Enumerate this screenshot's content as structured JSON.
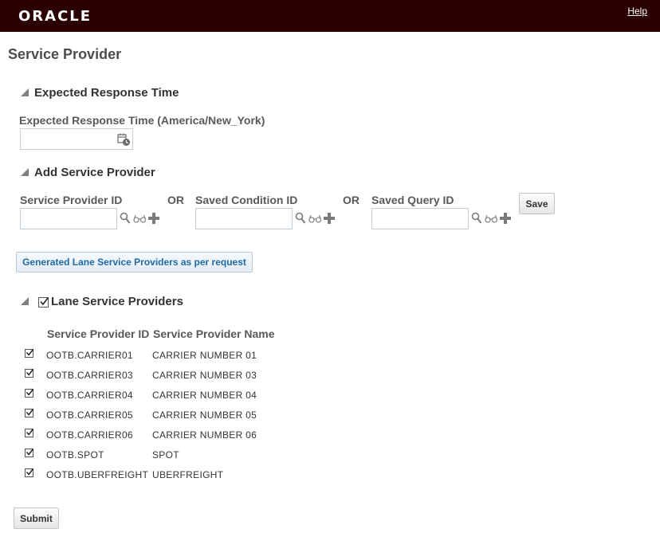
{
  "header": {
    "logo_text": "ORACLE",
    "help_label": "Help"
  },
  "page_title": "Service Provider",
  "expected_response": {
    "section_title": "Expected Response Time",
    "field_label": "Expected Response Time (America/New_York)",
    "value": "",
    "icon": "calendar-clock-icon"
  },
  "add_provider": {
    "section_title": "Add Service Provider",
    "or_label": "OR",
    "fields": [
      {
        "label": "Service Provider ID",
        "value": ""
      },
      {
        "label": "Saved Condition ID",
        "value": ""
      },
      {
        "label": "Saved Query ID",
        "value": ""
      }
    ],
    "field_icons": [
      "search-icon",
      "glasses-icon",
      "plus-icon"
    ],
    "save_label": "Save"
  },
  "generate_button_label": "Generated Lane Service Providers as per request",
  "lane_providers": {
    "section_title": "Lane Service Providers",
    "section_checked": true,
    "columns": [
      "Service Provider ID",
      "Service Provider Name"
    ],
    "rows": [
      {
        "checked": true,
        "id": "OOTB.CARRIER01",
        "name": "CARRIER NUMBER 01"
      },
      {
        "checked": true,
        "id": "OOTB.CARRIER03",
        "name": "CARRIER NUMBER 03"
      },
      {
        "checked": true,
        "id": "OOTB.CARRIER04",
        "name": "CARRIER NUMBER 04"
      },
      {
        "checked": true,
        "id": "OOTB.CARRIER05",
        "name": "CARRIER NUMBER 05"
      },
      {
        "checked": true,
        "id": "OOTB.CARRIER06",
        "name": "CARRIER NUMBER 06"
      },
      {
        "checked": true,
        "id": "OOTB.SPOT",
        "name": "SPOT"
      },
      {
        "checked": true,
        "id": "OOTB.UBERFREIGHT",
        "name": "UBERFREIGHT"
      }
    ]
  },
  "submit_label": "Submit",
  "colors": {
    "header_bg": "#2b0000",
    "link_blue": "#1f6aa6"
  }
}
